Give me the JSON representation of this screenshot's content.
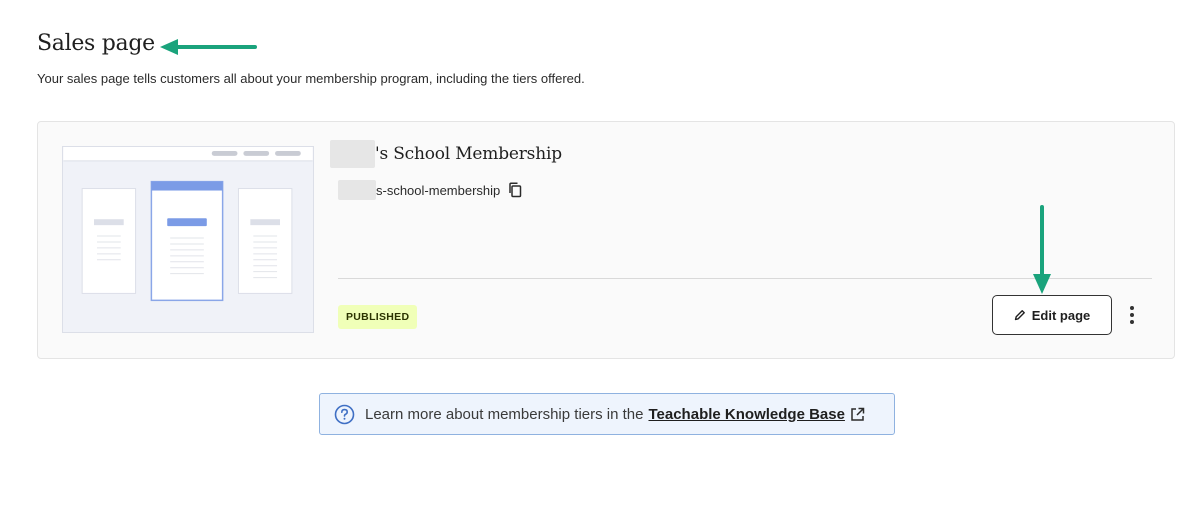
{
  "header": {
    "title": "Sales page",
    "description": "Your sales page tells customers all about your membership program, including the tiers offered."
  },
  "program": {
    "name_suffix": "'s School Membership",
    "slug_suffix": "s-school-membership",
    "status": "PUBLISHED",
    "edit_label": "Edit page"
  },
  "info": {
    "text": "Learn more about membership tiers in the",
    "link_label": "Teachable Knowledge Base"
  },
  "icons": {
    "copy": "copy-icon",
    "edit": "pencil-icon",
    "more": "more-vertical-icon",
    "help": "help-circle-icon",
    "external": "external-link-icon"
  },
  "colors": {
    "annotation_arrow": "#1aa37c",
    "badge_bg": "#f0ffb8",
    "info_border": "#8fb2e0",
    "info_bg": "#eef4fd",
    "thumb_accent": "#7b9be6"
  }
}
